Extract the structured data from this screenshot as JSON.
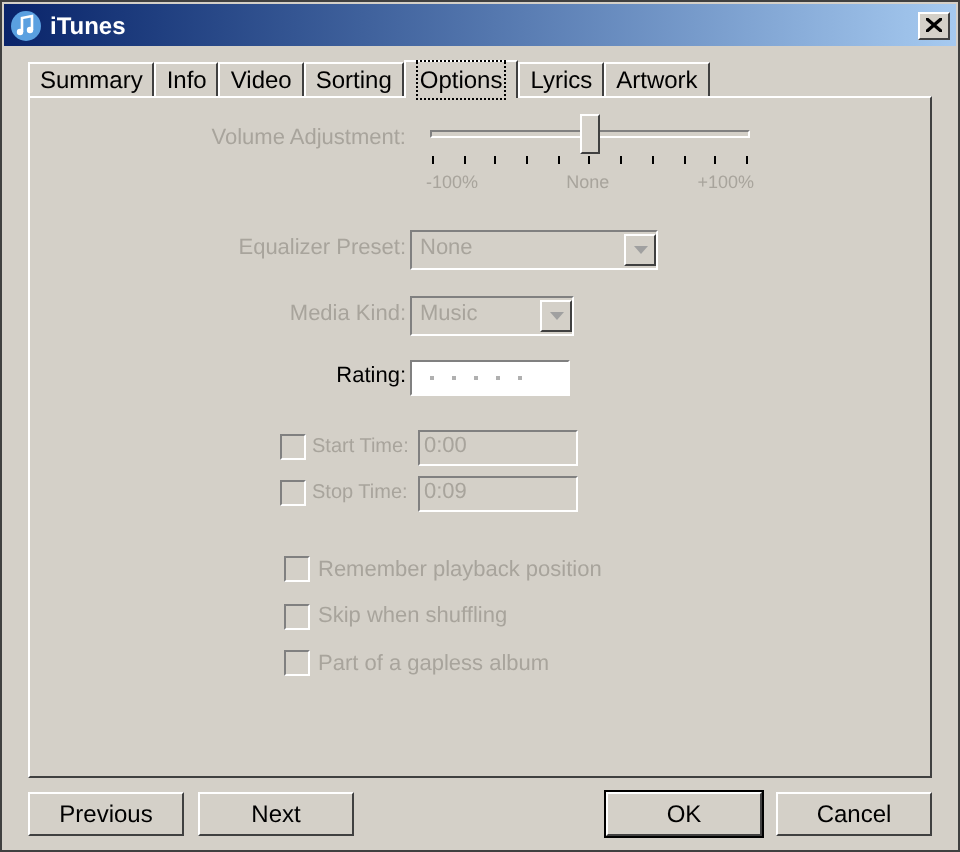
{
  "window": {
    "title": "iTunes"
  },
  "tabs": [
    {
      "label": "Summary",
      "selected": false
    },
    {
      "label": "Info",
      "selected": false
    },
    {
      "label": "Video",
      "selected": false
    },
    {
      "label": "Sorting",
      "selected": false
    },
    {
      "label": "Options",
      "selected": true
    },
    {
      "label": "Lyrics",
      "selected": false
    },
    {
      "label": "Artwork",
      "selected": false
    }
  ],
  "volume": {
    "label": "Volume Adjustment:",
    "level": 0.5,
    "disabled": true,
    "min_label": "-100%",
    "mid_label": "None",
    "max_label": "+100%"
  },
  "equalizer": {
    "label": "Equalizer Preset:",
    "value": "None",
    "disabled": true
  },
  "media_kind": {
    "label": "Media Kind:",
    "value": "Music",
    "disabled": true
  },
  "rating": {
    "label": "Rating:"
  },
  "times": [
    {
      "label": "Start Time:",
      "value": "0:00",
      "checked": false,
      "disabled": true
    },
    {
      "label": "Stop Time:",
      "value": "0:09",
      "checked": false,
      "disabled": true
    }
  ],
  "options": [
    {
      "label": "Remember playback position",
      "checked": false,
      "disabled": true
    },
    {
      "label": "Skip when shuffling",
      "checked": false,
      "disabled": true
    },
    {
      "label": "Part of a gapless album",
      "checked": false,
      "disabled": true
    }
  ],
  "buttons_left": [
    {
      "label": "Previous",
      "default": false
    },
    {
      "label": "Next",
      "default": false
    }
  ],
  "buttons_right": [
    {
      "label": "OK",
      "default": true
    },
    {
      "label": "Cancel",
      "default": false
    }
  ]
}
